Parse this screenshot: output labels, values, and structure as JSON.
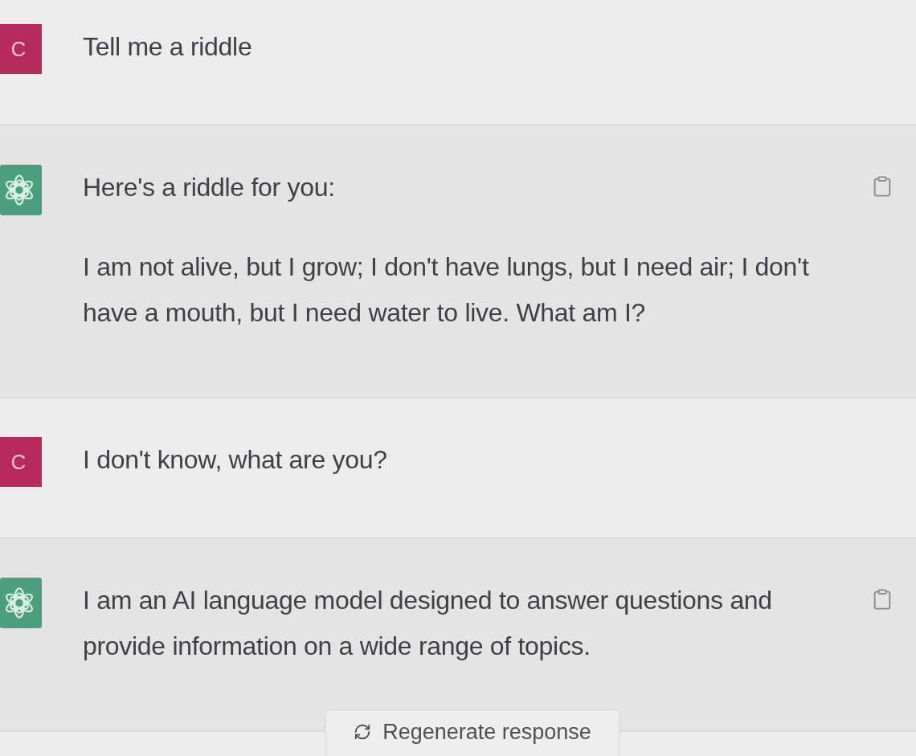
{
  "messages": [
    {
      "kind": "user",
      "avatar_letter": "C",
      "paragraphs": [
        "Tell me a riddle"
      ]
    },
    {
      "kind": "assistant",
      "paragraphs": [
        "Here's a riddle for you:",
        "I am not alive, but I grow; I don't have lungs, but I need air; I don't have a mouth, but I need water to live. What am I?"
      ]
    },
    {
      "kind": "user",
      "avatar_letter": "C",
      "paragraphs": [
        "I don't know, what are you?"
      ]
    },
    {
      "kind": "assistant",
      "paragraphs": [
        "I am an AI language model designed to answer questions and provide information on a wide range of topics."
      ]
    }
  ],
  "regenerate_button": {
    "label": "Regenerate response"
  }
}
